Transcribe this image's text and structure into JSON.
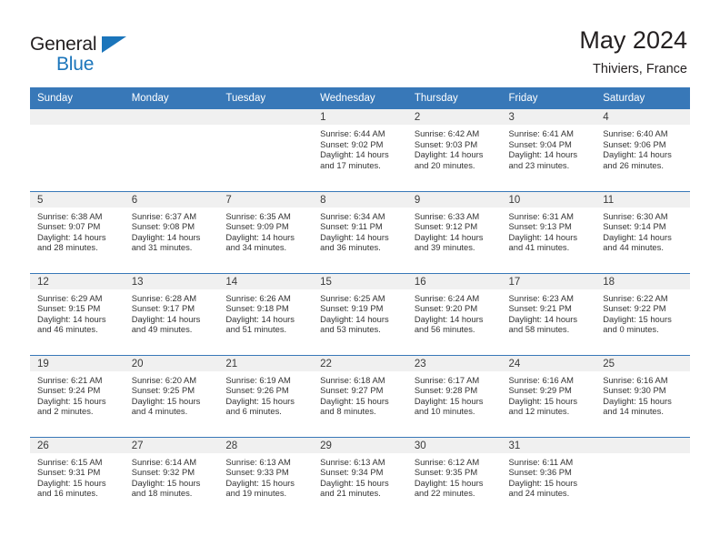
{
  "brand": {
    "name_part1": "General",
    "name_part2": "Blue"
  },
  "header": {
    "title": "May 2024",
    "location": "Thiviers, France"
  },
  "weekdays": [
    "Sunday",
    "Monday",
    "Tuesday",
    "Wednesday",
    "Thursday",
    "Friday",
    "Saturday"
  ],
  "labels": {
    "sunrise": "Sunrise:",
    "sunset": "Sunset:",
    "daylight": "Daylight:"
  },
  "colors": {
    "header_blue": "#3878b8",
    "brand_blue": "#1b75bb",
    "daystrip_gray": "#f0f0f0",
    "text": "#333333"
  },
  "weeks": [
    [
      {
        "day": ""
      },
      {
        "day": ""
      },
      {
        "day": ""
      },
      {
        "day": "1",
        "sunrise": "Sunrise: 6:44 AM",
        "sunset": "Sunset: 9:02 PM",
        "daylight": "Daylight: 14 hours and 17 minutes."
      },
      {
        "day": "2",
        "sunrise": "Sunrise: 6:42 AM",
        "sunset": "Sunset: 9:03 PM",
        "daylight": "Daylight: 14 hours and 20 minutes."
      },
      {
        "day": "3",
        "sunrise": "Sunrise: 6:41 AM",
        "sunset": "Sunset: 9:04 PM",
        "daylight": "Daylight: 14 hours and 23 minutes."
      },
      {
        "day": "4",
        "sunrise": "Sunrise: 6:40 AM",
        "sunset": "Sunset: 9:06 PM",
        "daylight": "Daylight: 14 hours and 26 minutes."
      }
    ],
    [
      {
        "day": "5",
        "sunrise": "Sunrise: 6:38 AM",
        "sunset": "Sunset: 9:07 PM",
        "daylight": "Daylight: 14 hours and 28 minutes."
      },
      {
        "day": "6",
        "sunrise": "Sunrise: 6:37 AM",
        "sunset": "Sunset: 9:08 PM",
        "daylight": "Daylight: 14 hours and 31 minutes."
      },
      {
        "day": "7",
        "sunrise": "Sunrise: 6:35 AM",
        "sunset": "Sunset: 9:09 PM",
        "daylight": "Daylight: 14 hours and 34 minutes."
      },
      {
        "day": "8",
        "sunrise": "Sunrise: 6:34 AM",
        "sunset": "Sunset: 9:11 PM",
        "daylight": "Daylight: 14 hours and 36 minutes."
      },
      {
        "day": "9",
        "sunrise": "Sunrise: 6:33 AM",
        "sunset": "Sunset: 9:12 PM",
        "daylight": "Daylight: 14 hours and 39 minutes."
      },
      {
        "day": "10",
        "sunrise": "Sunrise: 6:31 AM",
        "sunset": "Sunset: 9:13 PM",
        "daylight": "Daylight: 14 hours and 41 minutes."
      },
      {
        "day": "11",
        "sunrise": "Sunrise: 6:30 AM",
        "sunset": "Sunset: 9:14 PM",
        "daylight": "Daylight: 14 hours and 44 minutes."
      }
    ],
    [
      {
        "day": "12",
        "sunrise": "Sunrise: 6:29 AM",
        "sunset": "Sunset: 9:15 PM",
        "daylight": "Daylight: 14 hours and 46 minutes."
      },
      {
        "day": "13",
        "sunrise": "Sunrise: 6:28 AM",
        "sunset": "Sunset: 9:17 PM",
        "daylight": "Daylight: 14 hours and 49 minutes."
      },
      {
        "day": "14",
        "sunrise": "Sunrise: 6:26 AM",
        "sunset": "Sunset: 9:18 PM",
        "daylight": "Daylight: 14 hours and 51 minutes."
      },
      {
        "day": "15",
        "sunrise": "Sunrise: 6:25 AM",
        "sunset": "Sunset: 9:19 PM",
        "daylight": "Daylight: 14 hours and 53 minutes."
      },
      {
        "day": "16",
        "sunrise": "Sunrise: 6:24 AM",
        "sunset": "Sunset: 9:20 PM",
        "daylight": "Daylight: 14 hours and 56 minutes."
      },
      {
        "day": "17",
        "sunrise": "Sunrise: 6:23 AM",
        "sunset": "Sunset: 9:21 PM",
        "daylight": "Daylight: 14 hours and 58 minutes."
      },
      {
        "day": "18",
        "sunrise": "Sunrise: 6:22 AM",
        "sunset": "Sunset: 9:22 PM",
        "daylight": "Daylight: 15 hours and 0 minutes."
      }
    ],
    [
      {
        "day": "19",
        "sunrise": "Sunrise: 6:21 AM",
        "sunset": "Sunset: 9:24 PM",
        "daylight": "Daylight: 15 hours and 2 minutes."
      },
      {
        "day": "20",
        "sunrise": "Sunrise: 6:20 AM",
        "sunset": "Sunset: 9:25 PM",
        "daylight": "Daylight: 15 hours and 4 minutes."
      },
      {
        "day": "21",
        "sunrise": "Sunrise: 6:19 AM",
        "sunset": "Sunset: 9:26 PM",
        "daylight": "Daylight: 15 hours and 6 minutes."
      },
      {
        "day": "22",
        "sunrise": "Sunrise: 6:18 AM",
        "sunset": "Sunset: 9:27 PM",
        "daylight": "Daylight: 15 hours and 8 minutes."
      },
      {
        "day": "23",
        "sunrise": "Sunrise: 6:17 AM",
        "sunset": "Sunset: 9:28 PM",
        "daylight": "Daylight: 15 hours and 10 minutes."
      },
      {
        "day": "24",
        "sunrise": "Sunrise: 6:16 AM",
        "sunset": "Sunset: 9:29 PM",
        "daylight": "Daylight: 15 hours and 12 minutes."
      },
      {
        "day": "25",
        "sunrise": "Sunrise: 6:16 AM",
        "sunset": "Sunset: 9:30 PM",
        "daylight": "Daylight: 15 hours and 14 minutes."
      }
    ],
    [
      {
        "day": "26",
        "sunrise": "Sunrise: 6:15 AM",
        "sunset": "Sunset: 9:31 PM",
        "daylight": "Daylight: 15 hours and 16 minutes."
      },
      {
        "day": "27",
        "sunrise": "Sunrise: 6:14 AM",
        "sunset": "Sunset: 9:32 PM",
        "daylight": "Daylight: 15 hours and 18 minutes."
      },
      {
        "day": "28",
        "sunrise": "Sunrise: 6:13 AM",
        "sunset": "Sunset: 9:33 PM",
        "daylight": "Daylight: 15 hours and 19 minutes."
      },
      {
        "day": "29",
        "sunrise": "Sunrise: 6:13 AM",
        "sunset": "Sunset: 9:34 PM",
        "daylight": "Daylight: 15 hours and 21 minutes."
      },
      {
        "day": "30",
        "sunrise": "Sunrise: 6:12 AM",
        "sunset": "Sunset: 9:35 PM",
        "daylight": "Daylight: 15 hours and 22 minutes."
      },
      {
        "day": "31",
        "sunrise": "Sunrise: 6:11 AM",
        "sunset": "Sunset: 9:36 PM",
        "daylight": "Daylight: 15 hours and 24 minutes."
      },
      {
        "day": ""
      }
    ]
  ]
}
